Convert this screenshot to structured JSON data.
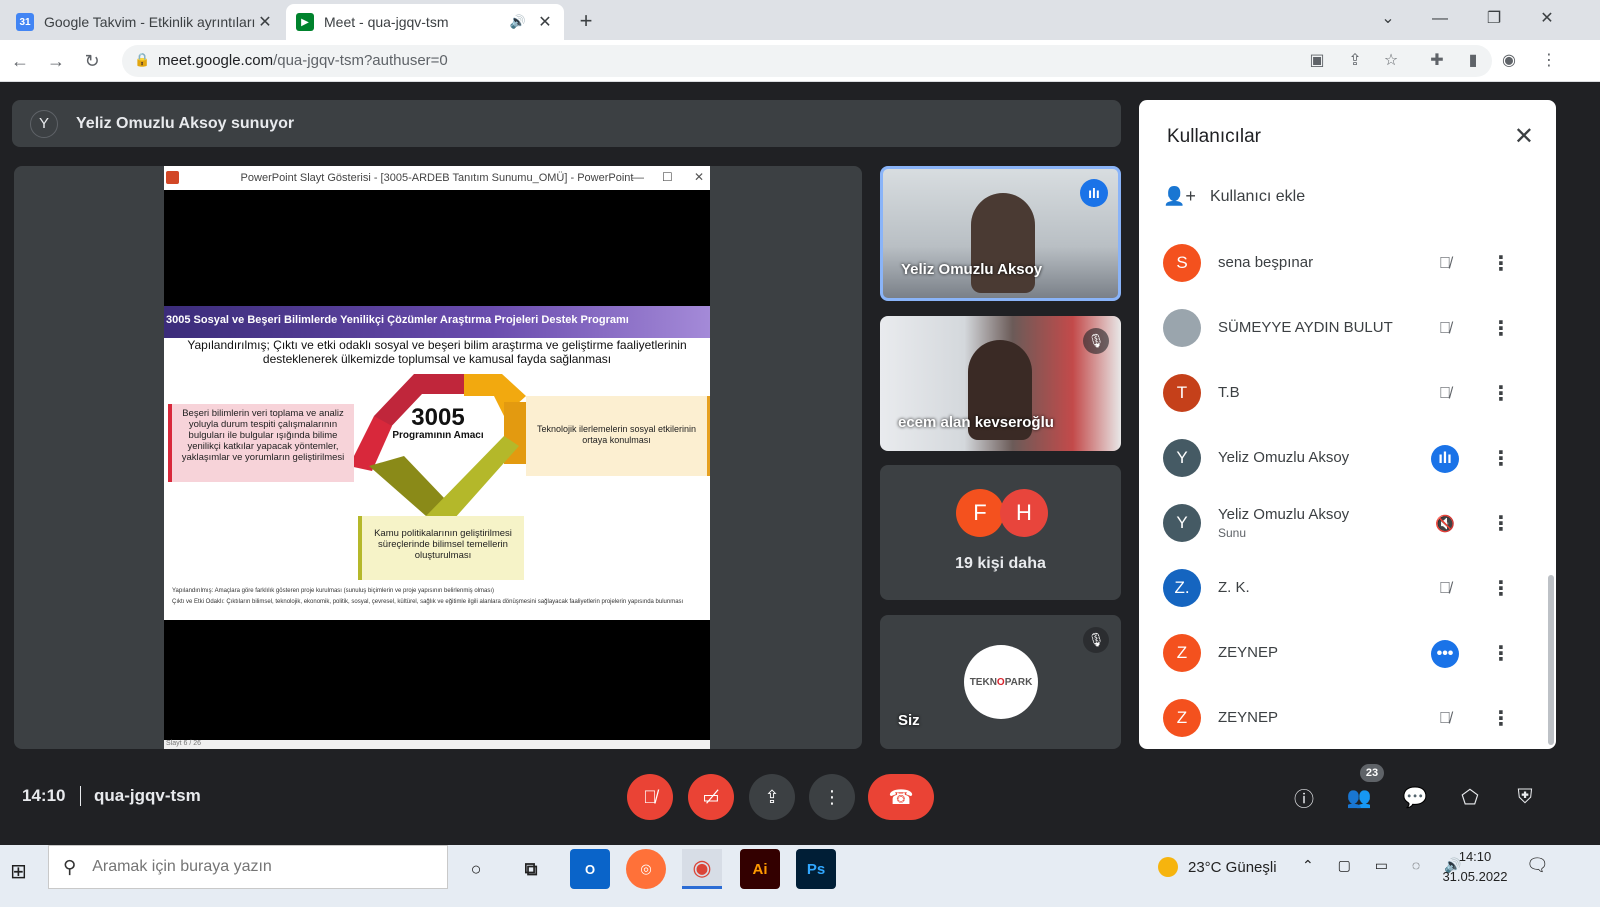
{
  "browser": {
    "tabs": [
      {
        "title": "Google Takvim - Etkinlik ayrıntıları",
        "favicon": "31",
        "favicon_color": "#4285f4"
      },
      {
        "title": "Meet - qua-jgqv-tsm",
        "favicon": "",
        "favicon_color": "#00832d"
      }
    ],
    "url_host": "meet.google.com",
    "url_path": "/qua-jgqv-tsm?authuser=0"
  },
  "meet": {
    "presenting": {
      "avatar_letter": "Y",
      "text": "Yeliz Omuzlu Aksoy sunuyor"
    },
    "slide": {
      "window_title": "PowerPoint Slayt Gösterisi - [3005-ARDEB Tanıtım Sunumu_OMÜ] - PowerPoint",
      "header": "3005 Sosyal ve Beşeri Bilimlerde Yenilikçi Çözümler Araştırma Projeleri Destek Programı",
      "subtitle": "Yapılandırılmış; Çıktı ve etki odaklı sosyal ve beşeri bilim araştırma ve geliştirme faaliyetlerinin desteklenerek ülkemizde toplumsal ve kamusal fayda sağlanması",
      "left_box": "Beşeri bilimlerin veri toplama ve analiz yoluyla durum tespiti çalışmalarının bulguları ile bulgular ışığında bilime yenilikçi katkılar yapacak yöntemler, yaklaşımlar ve yorumların geliştirilmesi",
      "right_box": "Teknolojik ilerlemelerin sosyal etkilerinin ortaya konulması",
      "bottom_box": "Kamu politikalarının geliştirilmesi süreçlerinde bilimsel temellerin oluşturulması",
      "center_number": "3005",
      "center_label": "Programının Amacı",
      "note1": "Yapılandırılmış: Amaçlara göre farklılık gösteren proje kurulması (sunuluş biçimlerin ve proje yapısının belirlenmiş olması)",
      "note2": "Çıktı ve Etki Odaklı: Çıktıların bilimsel, teknolojik, ekonomik, politik, sosyal, çevresel, kültürel, sağlık ve eğitimle ilgili alanlara dönüşmesini sağlayacak faaliyetlerin projelerin yapısında bulunması",
      "status": "Slayt 6 / 26"
    },
    "tiles": [
      {
        "name": "Yeliz Omuzlu Aksoy"
      },
      {
        "name": "ecem alan kevseroğlu"
      },
      {
        "letters": [
          "F",
          "H"
        ],
        "colors": [
          "#f4511e",
          "#e8453c"
        ],
        "more": "19 kişi daha"
      },
      {
        "name": "Siz",
        "logo_text_a": "TEKN",
        "logo_text_b": "O",
        "logo_text_c": "PARK"
      }
    ],
    "bottom": {
      "time": "14:10",
      "code": "qua-jgqv-tsm",
      "participant_count": "23"
    }
  },
  "panel": {
    "title": "Kullanıcılar",
    "add_user": "Kullanıcı ekle",
    "people": [
      {
        "initial": "S",
        "color": "#f4511e",
        "name": "sena beşpınar",
        "sub": "",
        "status": "muted"
      },
      {
        "initial": "",
        "color": "#9aa5ad",
        "name": "SÜMEYYE AYDIN BULUT",
        "sub": "",
        "status": "muted"
      },
      {
        "initial": "T",
        "color": "#c5401a",
        "name": "T.B",
        "sub": "",
        "status": "muted"
      },
      {
        "initial": "Y",
        "color": "#455a64",
        "name": "Yeliz Omuzlu Aksoy",
        "sub": "",
        "status": "speaking"
      },
      {
        "initial": "Y",
        "color": "#455a64",
        "name": "Yeliz Omuzlu Aksoy",
        "sub": "Sunu",
        "status": "audio-off"
      },
      {
        "initial": "Z.",
        "color": "#1565c0",
        "name": "Z. K.",
        "sub": "",
        "status": "muted"
      },
      {
        "initial": "Z",
        "color": "#f4511e",
        "name": "ZEYNEP",
        "sub": "",
        "status": "dots"
      },
      {
        "initial": "Z",
        "color": "#f4511e",
        "name": "ZEYNEP",
        "sub": "",
        "status": "muted"
      }
    ]
  },
  "taskbar": {
    "search_placeholder": "Aramak için buraya yazın",
    "weather": "23°C  Güneşli",
    "time": "14:10",
    "date": "31.05.2022"
  }
}
